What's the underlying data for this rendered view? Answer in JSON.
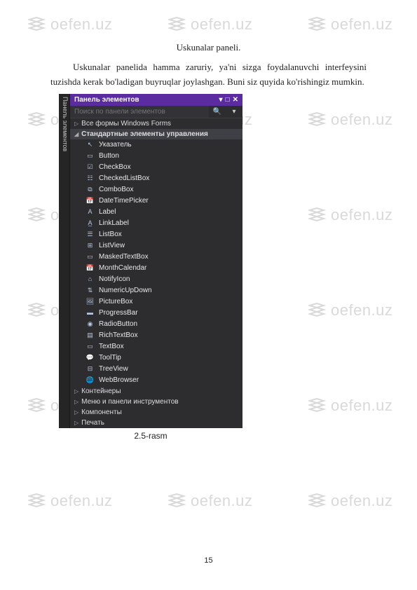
{
  "watermark_text": "oefen.uz",
  "doc": {
    "title": "Uskunalar paneli.",
    "paragraph": "Uskunalar panelida hamma zaruriy, ya'ni sizga foydalanuvchi interfeysini tuzishda kerak bo'ladigan buyruqlar joylashgan. Buni siz quyida ko'rishingiz mumkin.",
    "caption": "2.5-rasm",
    "page_number": "15"
  },
  "toolbox": {
    "side_tab": "Панель элементов",
    "title": "Панель элементов",
    "window_controls": [
      "▾",
      "□",
      "✕"
    ],
    "search_placeholder": "Поиск по панели элементов",
    "search_icon": "🔍",
    "search_dropdown": "▾",
    "groups": [
      {
        "label": "Все формы Windows Forms",
        "expanded": true
      },
      {
        "label": "Стандартные элементы управления",
        "expanded": true,
        "emph": true
      }
    ],
    "items": [
      {
        "icon": "↖",
        "label": "Указатель"
      },
      {
        "icon": "▭",
        "label": "Button"
      },
      {
        "icon": "☑",
        "label": "CheckBox"
      },
      {
        "icon": "☷",
        "label": "CheckedListBox"
      },
      {
        "icon": "⧉",
        "label": "ComboBox"
      },
      {
        "icon": "📅",
        "label": "DateTimePicker"
      },
      {
        "icon": "A",
        "label": "Label"
      },
      {
        "icon": "A̲",
        "label": "LinkLabel"
      },
      {
        "icon": "☰",
        "label": "ListBox"
      },
      {
        "icon": "⊞",
        "label": "ListView"
      },
      {
        "icon": "▭",
        "label": "MaskedTextBox"
      },
      {
        "icon": "📅",
        "label": "MonthCalendar"
      },
      {
        "icon": "⌂",
        "label": "NotifyIcon"
      },
      {
        "icon": "⇅",
        "label": "NumericUpDown"
      },
      {
        "icon": "🖼",
        "label": "PictureBox"
      },
      {
        "icon": "▬",
        "label": "ProgressBar"
      },
      {
        "icon": "◉",
        "label": "RadioButton"
      },
      {
        "icon": "▤",
        "label": "RichTextBox"
      },
      {
        "icon": "▭",
        "label": "TextBox"
      },
      {
        "icon": "💬",
        "label": "ToolTip"
      },
      {
        "icon": "⊟",
        "label": "TreeView"
      },
      {
        "icon": "🌐",
        "label": "WebBrowser"
      }
    ],
    "trailing_groups": [
      "Контейнеры",
      "Меню и панели инструментов",
      "Компоненты",
      "Печать"
    ]
  }
}
